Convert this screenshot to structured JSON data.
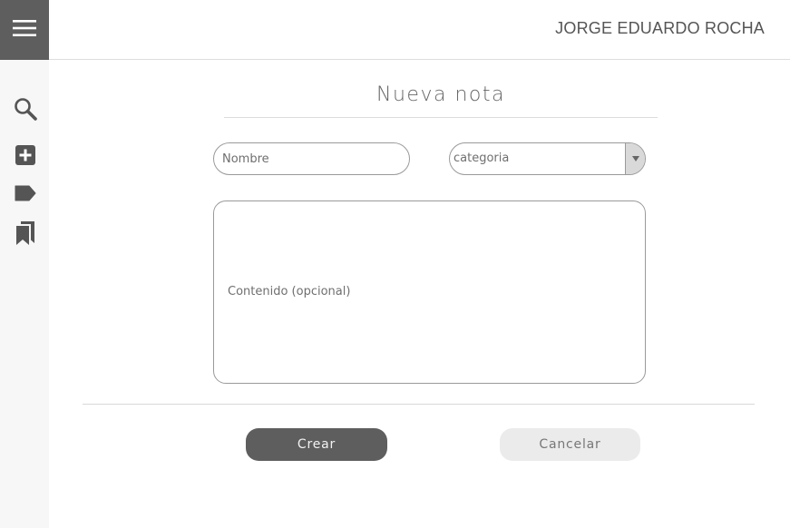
{
  "header": {
    "user_name": "JORGE EDUARDO ROCHA"
  },
  "sidebar": {
    "items": [
      {
        "icon": "search-icon"
      },
      {
        "icon": "add-note-icon"
      },
      {
        "icon": "tag-icon"
      },
      {
        "icon": "bookmarks-icon"
      }
    ]
  },
  "form": {
    "title": "Nueva nota",
    "name_placeholder": "Nombre",
    "category_selected": "categoria",
    "content_placeholder": "Contenido (opcional)",
    "create_label": "Crear",
    "cancel_label": "Cancelar"
  },
  "colors": {
    "sidebar_bg": "#f7f7f7",
    "menu_bg": "#5e5e5e",
    "primary_button": "#5e5e5e",
    "secondary_button": "#ebebeb"
  }
}
